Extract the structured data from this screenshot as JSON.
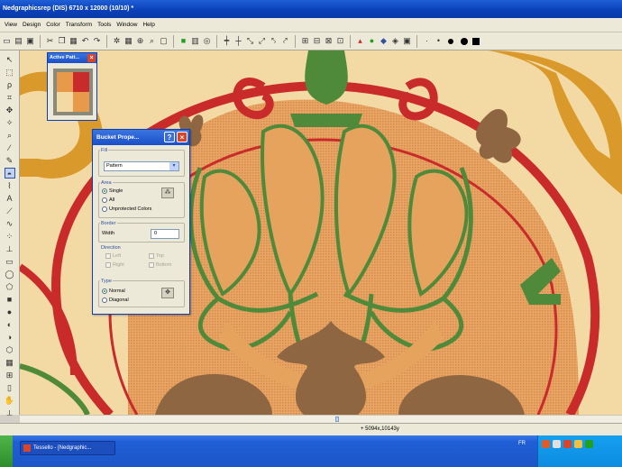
{
  "window": {
    "title": "Nedgraphicsrep (DIS) 6710 x 12000 (10/10) *"
  },
  "menu": [
    "View",
    "Design",
    "Color",
    "Transform",
    "Tools",
    "Window",
    "Help"
  ],
  "colors": {
    "cream": "#f3d9a4",
    "orange": "#e6a35e",
    "red": "#c92a2a",
    "green": "#4f8a3a",
    "brown": "#8e6642",
    "mustard": "#d99a2b",
    "selection_blue": "#0a3fb8"
  },
  "active_pattern": {
    "title": "Active Patt...",
    "close": "×",
    "swatch": [
      "#e89a4a",
      "#c92a2a",
      "#f3d9a4",
      "#e89a4a"
    ]
  },
  "bucket_dialog": {
    "title": "Bucket Prope...",
    "help": "?",
    "close": "×",
    "fill": {
      "label": "Fill",
      "value": "Pattern"
    },
    "area": {
      "label": "Area",
      "options": [
        "Single",
        "All",
        "Unprotected Colors"
      ],
      "selected": "Single"
    },
    "border": {
      "label": "Border",
      "width_label": "Width",
      "width_value": "0"
    },
    "direction": {
      "label": "Direction",
      "options": [
        "Left",
        "Top",
        "Right",
        "Bottom"
      ]
    },
    "type": {
      "label": "Type",
      "options": [
        "Normal",
        "Diagonal"
      ],
      "selected": "Normal"
    }
  },
  "status": {
    "coords": "+ 5094x,10143y"
  },
  "taskbar": {
    "item": "Tessello - [Nedgraphic...",
    "lang": "FR"
  }
}
